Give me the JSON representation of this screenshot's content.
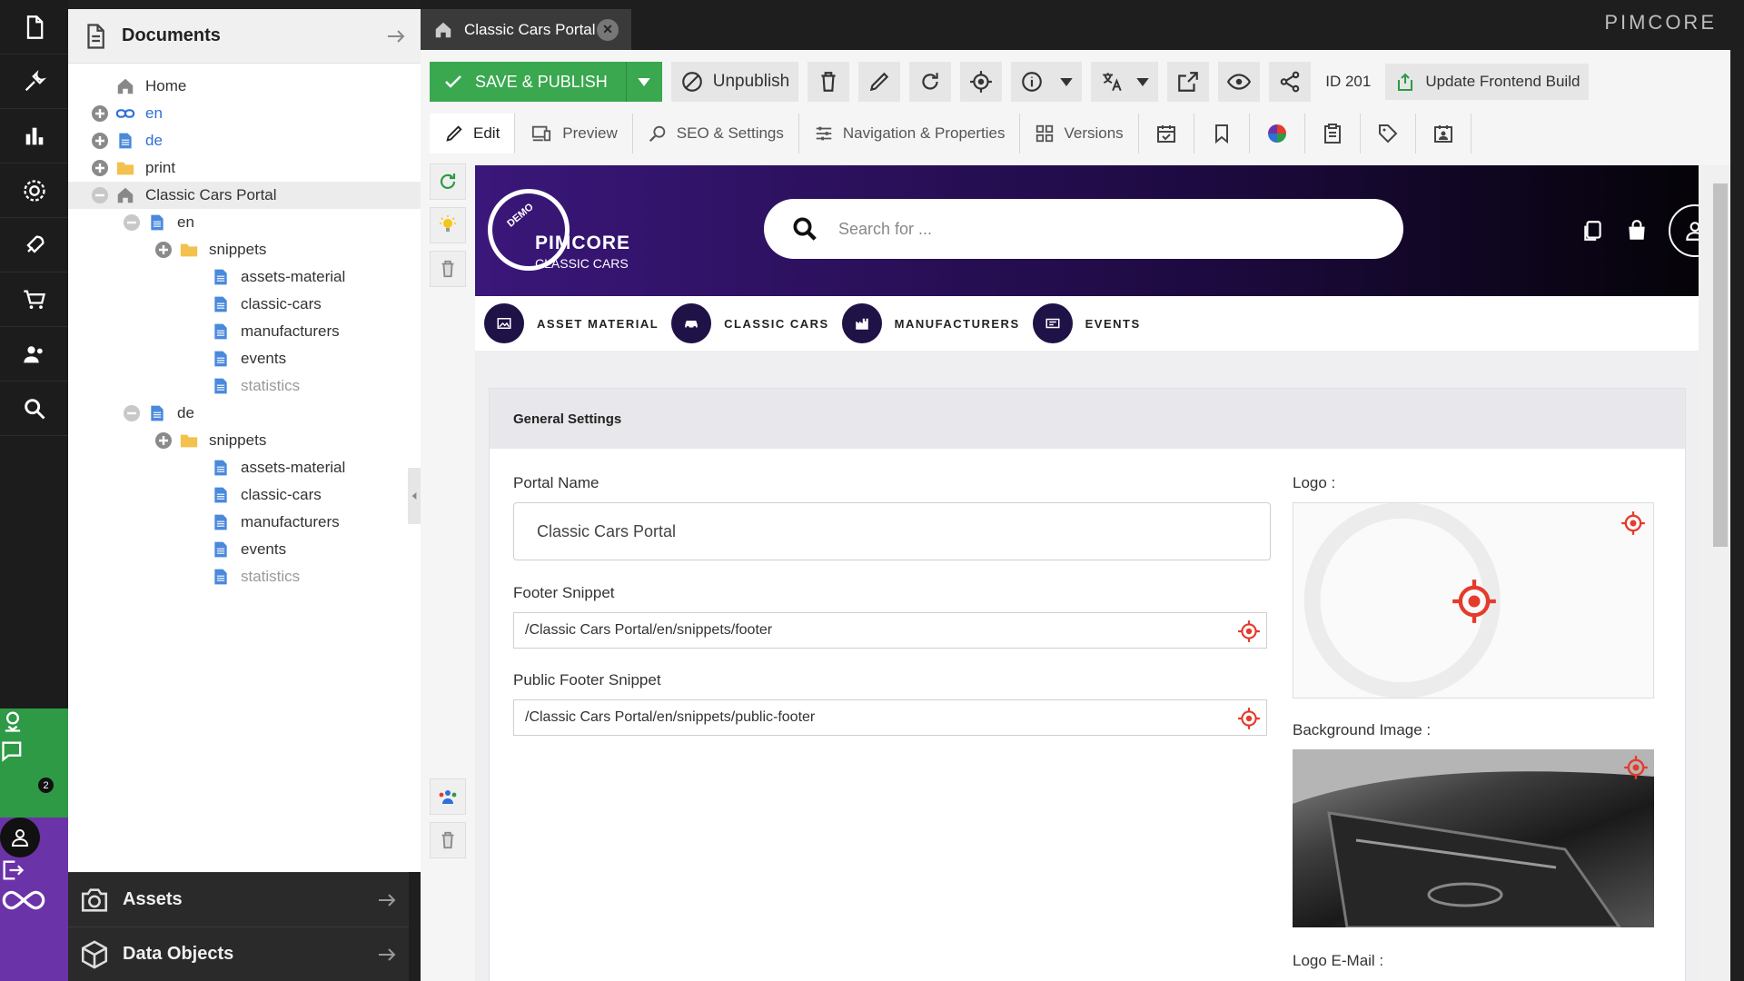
{
  "tree": {
    "title": "Documents",
    "items": [
      {
        "label": "Home",
        "icon": "home-icon",
        "indent": 0,
        "toggle": "none",
        "style": "normal"
      },
      {
        "label": "en",
        "icon": "link-icon",
        "indent": 0,
        "toggle": "plus",
        "style": "link"
      },
      {
        "label": "de",
        "icon": "page-icon",
        "indent": 0,
        "toggle": "plus",
        "style": "link"
      },
      {
        "label": "print",
        "icon": "folder-icon",
        "indent": 0,
        "toggle": "plus",
        "style": "normal"
      },
      {
        "label": "Classic Cars Portal",
        "icon": "home-icon",
        "indent": 0,
        "toggle": "minus",
        "style": "normal",
        "selected": true
      },
      {
        "label": "en",
        "icon": "page-icon",
        "indent": 1,
        "toggle": "minus",
        "style": "normal"
      },
      {
        "label": "snippets",
        "icon": "folder-icon",
        "indent": 2,
        "toggle": "plus",
        "style": "normal"
      },
      {
        "label": "assets-material",
        "icon": "page-icon",
        "indent": 3,
        "toggle": "none",
        "style": "normal"
      },
      {
        "label": "classic-cars",
        "icon": "page-icon",
        "indent": 3,
        "toggle": "none",
        "style": "normal"
      },
      {
        "label": "manufacturers",
        "icon": "page-icon",
        "indent": 3,
        "toggle": "none",
        "style": "normal"
      },
      {
        "label": "events",
        "icon": "page-icon",
        "indent": 3,
        "toggle": "none",
        "style": "normal"
      },
      {
        "label": "statistics",
        "icon": "page-icon",
        "indent": 3,
        "toggle": "none",
        "style": "muted"
      },
      {
        "label": "de",
        "icon": "page-icon",
        "indent": 1,
        "toggle": "minus",
        "style": "normal"
      },
      {
        "label": "snippets",
        "icon": "folder-icon",
        "indent": 2,
        "toggle": "plus",
        "style": "normal"
      },
      {
        "label": "assets-material",
        "icon": "page-icon",
        "indent": 3,
        "toggle": "none",
        "style": "normal"
      },
      {
        "label": "classic-cars",
        "icon": "page-icon",
        "indent": 3,
        "toggle": "none",
        "style": "normal"
      },
      {
        "label": "manufacturers",
        "icon": "page-icon",
        "indent": 3,
        "toggle": "none",
        "style": "normal"
      },
      {
        "label": "events",
        "icon": "page-icon",
        "indent": 3,
        "toggle": "none",
        "style": "normal"
      },
      {
        "label": "statistics",
        "icon": "page-icon",
        "indent": 3,
        "toggle": "none",
        "style": "muted"
      }
    ]
  },
  "accordion": {
    "assets": "Assets",
    "data_objects": "Data Objects"
  },
  "rail": {
    "notification_count": "2"
  },
  "tab": {
    "title": "Classic Cars Portal"
  },
  "brand": "PIMCORE",
  "toolbar": {
    "save_publish": "SAVE & PUBLISH",
    "unpublish": "Unpublish",
    "id_label": "ID 201",
    "update_build": "Update Frontend Build"
  },
  "subtabs": {
    "edit": "Edit",
    "preview": "Preview",
    "seo": "SEO & Settings",
    "nav": "Navigation & Properties",
    "versions": "Versions"
  },
  "site": {
    "logo_title": "PIMCORE",
    "logo_sub": "CLASSIC CARS",
    "logo_demo": "DEMO",
    "search_placeholder": "Search for ...",
    "nav": [
      "ASSET MATERIAL",
      "CLASSIC CARS",
      "MANUFACTURERS",
      "EVENTS"
    ]
  },
  "form": {
    "section_title": "General Settings",
    "portal_name_label": "Portal Name",
    "portal_name_value": "Classic Cars Portal",
    "footer_snippet_label": "Footer Snippet",
    "footer_snippet_value": "/Classic Cars Portal/en/snippets/footer",
    "public_footer_label": "Public Footer Snippet",
    "public_footer_value": "/Classic Cars Portal/en/snippets/public-footer",
    "logo_label": "Logo :",
    "bg_label": "Background Image :",
    "logo_email_label": "Logo E-Mail :"
  },
  "colors": {
    "accent_green": "#3aa84f",
    "rail_green": "#2e9a45",
    "rail_purple": "#6b33a8",
    "target_red": "#e53b2c"
  }
}
